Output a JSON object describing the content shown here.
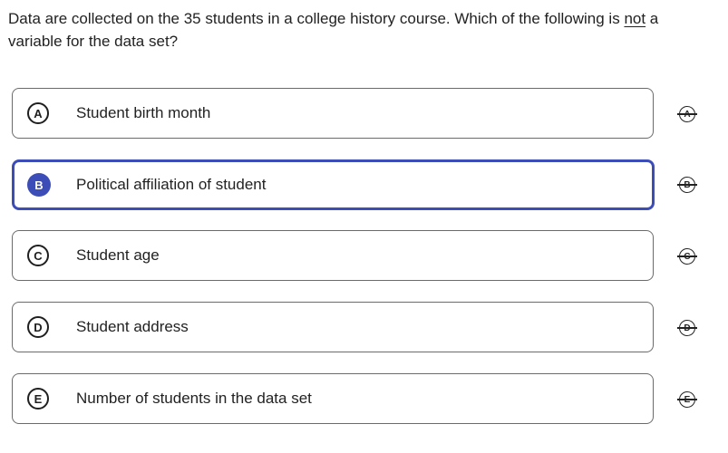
{
  "question": {
    "text_before": "Data are collected on the 35 students in a college history course. Which of the following is ",
    "emphasis": "not",
    "text_after": " a variable for the data set?"
  },
  "choices": [
    {
      "letter": "A",
      "text": "Student birth month",
      "selected": false
    },
    {
      "letter": "B",
      "text": "Political affiliation of student",
      "selected": true
    },
    {
      "letter": "C",
      "text": "Student age",
      "selected": false
    },
    {
      "letter": "D",
      "text": "Student address",
      "selected": false
    },
    {
      "letter": "E",
      "text": "Number of students in the data set",
      "selected": false
    }
  ],
  "eliminators": [
    {
      "letter": "A",
      "icon": "strikethrough-letter-icon"
    },
    {
      "letter": "B",
      "icon": "strikethrough-letter-icon"
    },
    {
      "letter": "C",
      "icon": "strikethrough-letter-icon"
    },
    {
      "letter": "D",
      "icon": "strikethrough-letter-icon"
    },
    {
      "letter": "E",
      "icon": "strikethrough-letter-icon"
    }
  ],
  "colors": {
    "accent": "#3d4db7",
    "border": "#6b6b6b",
    "text": "#222222"
  }
}
